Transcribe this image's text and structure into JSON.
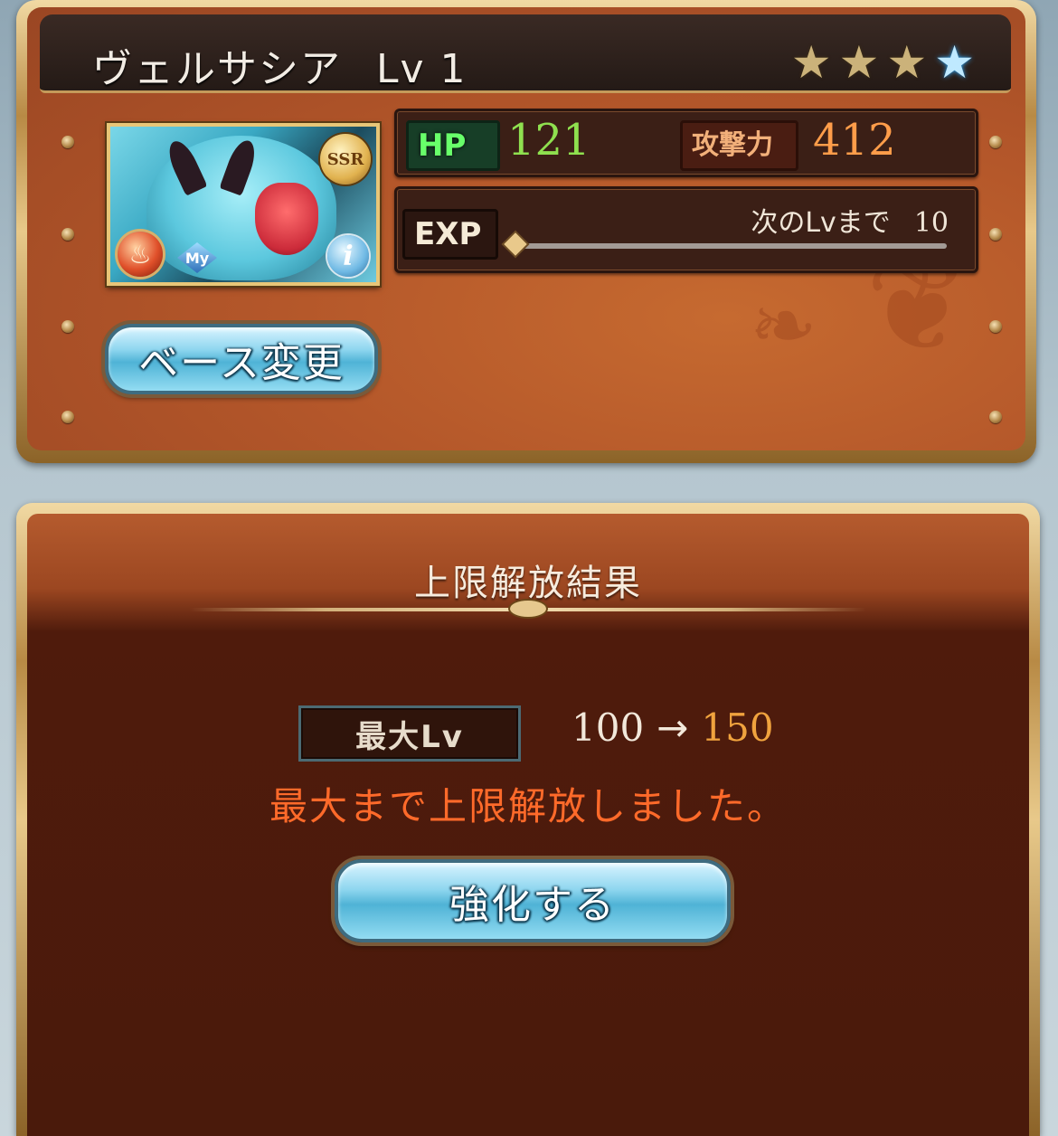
{
  "character": {
    "name": "ヴェルサシア",
    "level_label": "Lv 1",
    "stars": [
      "gold",
      "gold",
      "gold",
      "blue"
    ],
    "rarity": "SSR",
    "my_badge": "My",
    "info_badge": "i",
    "element": "fire"
  },
  "stats": {
    "hp_label": "HP",
    "hp_value": "121",
    "attack_label": "攻撃力",
    "attack_value": "412",
    "exp_label": "EXP",
    "next_level_label": "次のLvまで",
    "next_level_value": "10",
    "exp_progress": 0
  },
  "buttons": {
    "change_base": "ベース変更",
    "enhance": "強化する"
  },
  "limit_break": {
    "heading": "上限解放結果",
    "max_lv_label": "最大Lv",
    "old_max": "100",
    "arrow": "→",
    "new_max": "150",
    "message": "最大まで上限解放しました。"
  },
  "colors": {
    "hp_value": "#8fe04f",
    "attack_value": "#ff9d4a",
    "message": "#ff6a2a",
    "new_max": "#f0a33e"
  }
}
